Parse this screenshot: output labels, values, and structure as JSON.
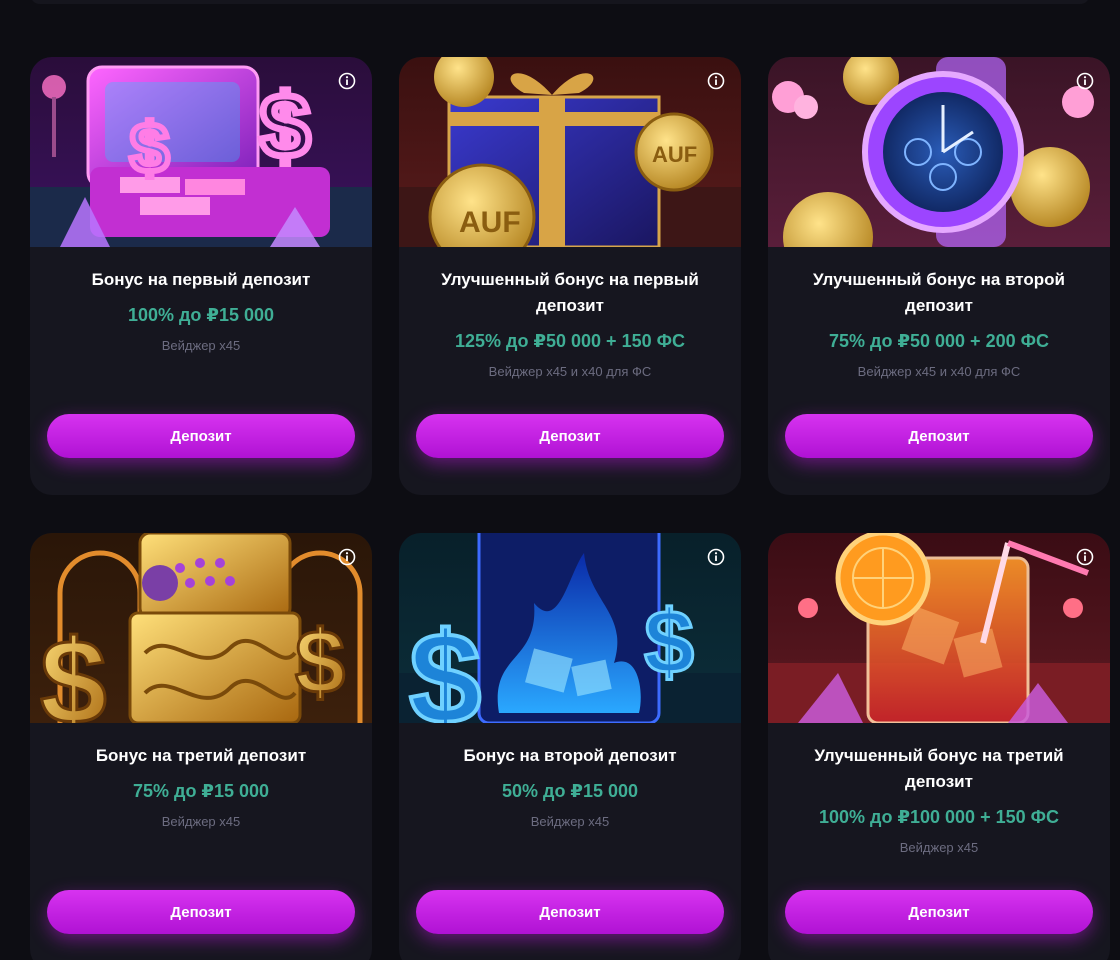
{
  "colors": {
    "background": "#0d0d13",
    "card": "#16161f",
    "amount": "#3fae95",
    "wager": "#6c6c80",
    "button_start": "#d733f0",
    "button_end": "#b012d4"
  },
  "bonuses": [
    {
      "title": "Бонус на первый депозит",
      "amount": "100% до ₽15 000",
      "wager": "Вейджер x45",
      "button_label": "Депозит",
      "image_icon": "treasure-case-with-dollars-icon",
      "info_icon": "info-icon"
    },
    {
      "title": "Улучшенный бонус на первый депозит",
      "amount": "125% до ₽50 000 + 150 ФС",
      "wager": "Вейджер x45 и x40 для ФС",
      "button_label": "Депозит",
      "image_icon": "gift-box-with-coins-icon",
      "info_icon": "info-icon"
    },
    {
      "title": "Улучшенный бонус на второй депозит",
      "amount": "75% до ₽50 000 + 200 ФС",
      "wager": "Вейджер x45 и x40 для ФС",
      "button_label": "Депозит",
      "image_icon": "luxury-watch-with-coins-icon",
      "info_icon": "info-icon"
    },
    {
      "title": "Бонус на третий депозит",
      "amount": "75% до ₽15 000",
      "wager": "Вейджер x45",
      "button_label": "Депозит",
      "image_icon": "golden-lighter-with-dollars-icon",
      "info_icon": "info-icon"
    },
    {
      "title": "Бонус на второй депозит",
      "amount": "50% до ₽15 000",
      "wager": "Вейджер x45",
      "button_label": "Депозит",
      "image_icon": "ice-glass-with-dollars-icon",
      "info_icon": "info-icon"
    },
    {
      "title": "Улучшенный бонус на третий депозит",
      "amount": "100% до ₽100 000 + 150 ФС",
      "wager": "Вейджер x45",
      "button_label": "Депозит",
      "image_icon": "cocktail-glass-icon",
      "info_icon": "info-icon"
    }
  ]
}
